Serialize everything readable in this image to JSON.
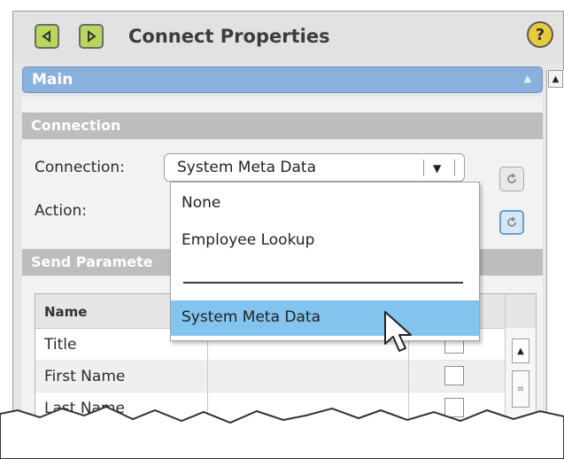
{
  "window": {
    "title": "Connect Properties",
    "help_glyph": "?"
  },
  "main_section": {
    "label": "Main"
  },
  "connection_section": {
    "label": "Connection",
    "connection_label": "Connection:",
    "action_label": "Action:",
    "connection_value": "System Meta Data"
  },
  "send_parameters": {
    "label": "Send Paramete",
    "columns": {
      "name": "Name",
      "flag": ""
    },
    "rows": [
      "Title",
      "First Name",
      "Last Name"
    ]
  },
  "dropdown": {
    "options": [
      "None",
      "Employee Lookup",
      "System Meta Data"
    ],
    "selected": "System Meta Data"
  },
  "colors": {
    "accent_blue": "#8ab0de",
    "highlight": "#82c4ee",
    "nav_green": "#b9d75a",
    "help_yellow": "#e6cc3c"
  }
}
